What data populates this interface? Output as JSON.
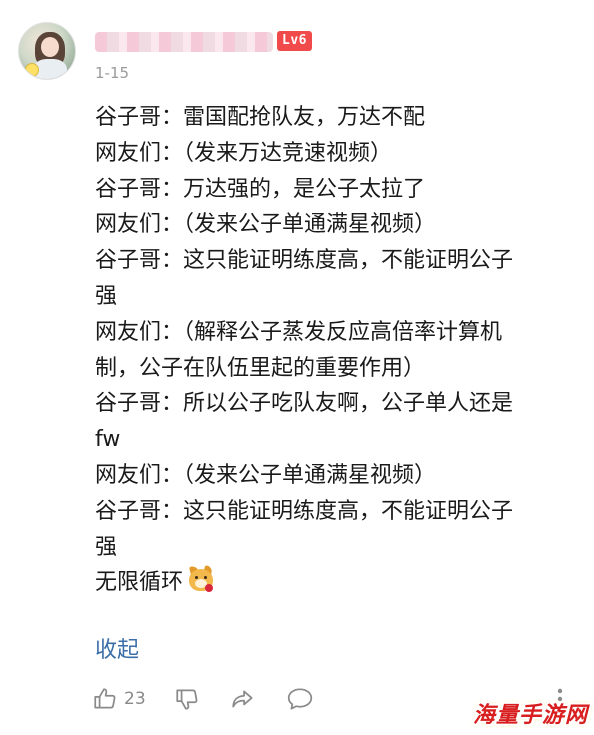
{
  "comment": {
    "level_badge": "Lv6",
    "date": "1-15",
    "lines": [
      "谷子哥：雷国配抢队友，万达不配",
      "网友们：（发来万达竞速视频）",
      "谷子哥：万达强的，是公子太拉了",
      "网友们：（发来公子单通满星视频）",
      "谷子哥：这只能证明练度高，不能证明公子",
      "强",
      "网友们：（解释公子蒸发反应高倍率计算机",
      "制，公子在队伍里起的重要作用）",
      "谷子哥：所以公子吃队友啊，公子单人还是",
      "fw",
      "网友们：（发来公子单通满星视频）",
      "谷子哥：这只能证明练度高，不能证明公子",
      "强",
      "无限循环"
    ],
    "collapse_label": "收起",
    "like_count": "23"
  },
  "icons": {
    "avatar": "user-avatar",
    "emoji": "doge-rose-emoji",
    "like": "thumbs-up-icon",
    "dislike": "thumbs-down-icon",
    "share": "share-icon",
    "reply": "comment-bubble-icon",
    "more": "more-vertical-icon"
  },
  "watermark": "海量手游网",
  "colors": {
    "level_badge": "#f04a4a",
    "link": "#3b6ea8",
    "meta": "#9a9a9a",
    "watermark": "#d81e1e"
  }
}
